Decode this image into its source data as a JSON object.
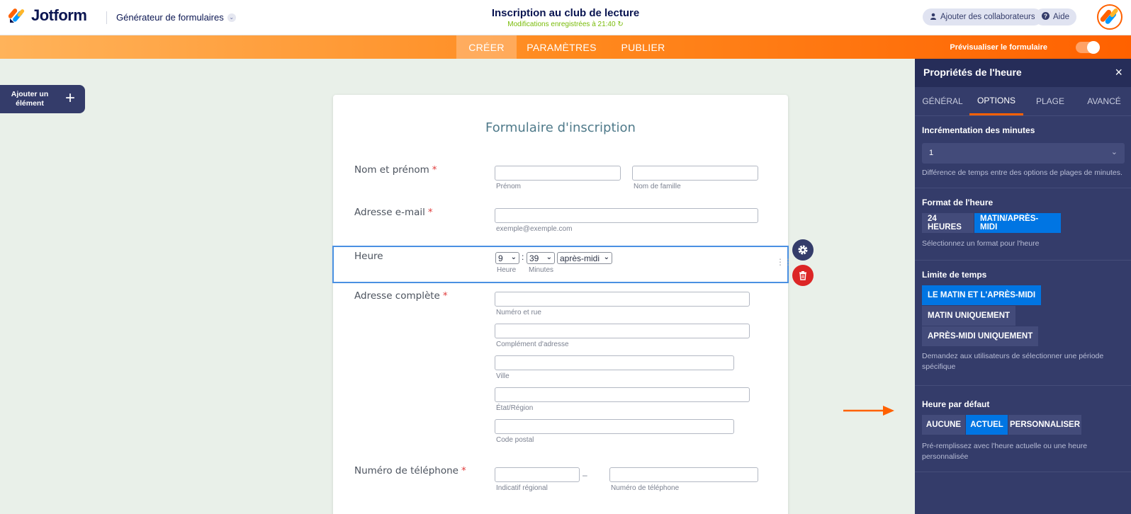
{
  "header": {
    "brand": "Jotform",
    "builder_menu": "Générateur de formulaires",
    "form_title": "Inscription au club de lecture",
    "save_status": "Modifications enregistrées à 21:40",
    "collaborators_label": "Ajouter des collaborateurs",
    "help_label": "Aide"
  },
  "nav": {
    "tabs": [
      {
        "label": "CRÉER",
        "active": true
      },
      {
        "label": "PARAMÈTRES",
        "active": false
      },
      {
        "label": "PUBLIER",
        "active": false
      }
    ],
    "preview_label": "Prévisualiser le formulaire"
  },
  "add_element": {
    "label": "Ajouter un élément",
    "plus": "+"
  },
  "form": {
    "title": "Formulaire d'inscription",
    "fields": {
      "name": {
        "label": "Nom et prénom",
        "first": "Prénom",
        "last": "Nom de famille"
      },
      "email": {
        "label": "Adresse e-mail",
        "sublabel": "exemple@exemple.com"
      },
      "time": {
        "label": "Heure",
        "hour": "9",
        "minute": "39",
        "ampm": "après-midi",
        "hour_label": "Heure",
        "minute_label": "Minutes",
        "separator": ":"
      },
      "address": {
        "label": "Adresse complète",
        "sub": [
          "Numéro et rue",
          "Complément d'adresse",
          "Ville",
          "État/Région",
          "Code postal"
        ]
      },
      "phone": {
        "label": "Numéro de téléphone",
        "area": "Indicatif régional",
        "number": "Numéro de téléphone",
        "dash": "–"
      }
    },
    "required_mark": "*"
  },
  "panel": {
    "title": "Propriétés de l'heure",
    "close": "×",
    "tabs": [
      {
        "label": "GÉNÉRAL",
        "active": false
      },
      {
        "label": "OPTIONS",
        "active": true
      },
      {
        "label": "PLAGE",
        "active": false
      },
      {
        "label": "AVANCÉ",
        "active": false
      }
    ],
    "minutes_increment": {
      "title": "Incrémentation des minutes",
      "value": "1",
      "desc": "Différence de temps entre des options de plages de minutes."
    },
    "time_format": {
      "title": "Format de l'heure",
      "options": [
        "24 HEURES",
        "MATIN/APRÈS-MIDI"
      ],
      "selected": "MATIN/APRÈS-MIDI",
      "desc": "Sélectionnez un format pour l'heure"
    },
    "time_limit": {
      "title": "Limite de temps",
      "options": [
        "LE MATIN ET L'APRÈS-MIDI",
        "MATIN UNIQUEMENT",
        "APRÈS-MIDI UNIQUEMENT"
      ],
      "selected": "LE MATIN ET L'APRÈS-MIDI",
      "desc": "Demandez aux utilisateurs de sélectionner une période spécifique"
    },
    "default_time": {
      "title": "Heure par défaut",
      "options": [
        "AUCUNE",
        "ACTUEL",
        "PERSONNALISER"
      ],
      "selected": "ACTUEL",
      "desc": "Pré-remplissez avec l'heure actuelle ou une heure personnalisée"
    }
  },
  "colors": {
    "orange": "#ff6100",
    "navy": "#343c6a",
    "blue": "#0075e3",
    "danger": "#dc2626"
  }
}
